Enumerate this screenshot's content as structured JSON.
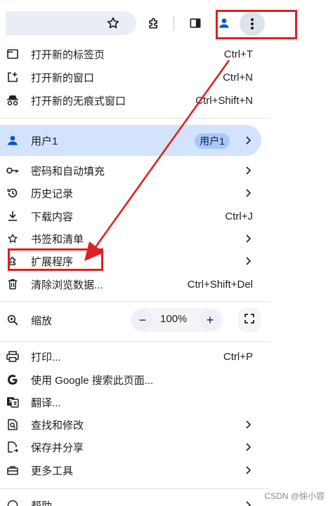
{
  "toolbar": {
    "icons": [
      "star-icon",
      "extensions-puzzle-icon",
      "side-panel-icon",
      "profile-icon",
      "more-vert-icon"
    ]
  },
  "menu": {
    "items_top": [
      {
        "label": "打开新的标签页",
        "shortcut": "Ctrl+T",
        "icon": "new-tab-icon"
      },
      {
        "label": "打开新的窗口",
        "shortcut": "Ctrl+N",
        "icon": "new-window-icon"
      },
      {
        "label": "打开新的无痕式窗口",
        "shortcut": "Ctrl+Shift+N",
        "icon": "incognito-icon"
      }
    ],
    "user": {
      "label": "用户1",
      "badge": "用户1"
    },
    "items_mid": [
      {
        "label": "密码和自动填充",
        "icon": "key-icon"
      },
      {
        "label": "历史记录",
        "icon": "history-icon"
      },
      {
        "label": "下载内容",
        "shortcut": "Ctrl+J",
        "icon": "download-icon"
      },
      {
        "label": "书签和清单",
        "icon": "bookmark-star-icon"
      },
      {
        "label": "扩展程序",
        "icon": "extensions-icon"
      },
      {
        "label": "清除浏览数据...",
        "shortcut": "Ctrl+Shift+Del",
        "icon": "trash-icon"
      }
    ],
    "zoom": {
      "label": "缩放",
      "minus": "−",
      "value": "100%",
      "plus": "+"
    },
    "items_bottom": [
      {
        "label": "打印...",
        "shortcut": "Ctrl+P",
        "icon": "print-icon"
      },
      {
        "label": "使用 Google 搜索此页面...",
        "icon": "google-icon"
      },
      {
        "label": "翻译...",
        "icon": "translate-icon"
      },
      {
        "label": "查找和修改",
        "icon": "find-icon"
      },
      {
        "label": "保存并分享",
        "icon": "save-share-icon"
      },
      {
        "label": "更多工具",
        "icon": "tools-icon"
      }
    ],
    "cutoff_item": {
      "label": "帮助"
    }
  },
  "watermark": "CSDN @徐小容",
  "colors": {
    "highlight": "#d3e3fd",
    "annotation": "#e02020"
  }
}
